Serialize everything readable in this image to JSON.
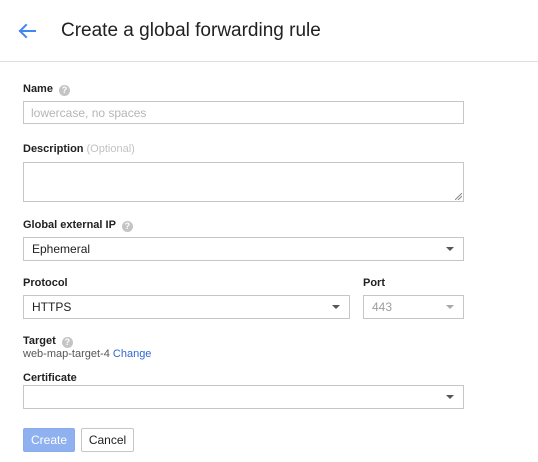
{
  "header": {
    "title": "Create a global forwarding rule",
    "back_icon": "arrow-left-icon"
  },
  "form": {
    "name": {
      "label": "Name",
      "help_icon": "help-icon",
      "value": "",
      "placeholder": "lowercase, no spaces"
    },
    "description": {
      "label": "Description",
      "optional_hint": "(Optional)",
      "value": ""
    },
    "global_ip": {
      "label": "Global external IP",
      "help_icon": "help-icon",
      "selected": "Ephemeral"
    },
    "protocol": {
      "label": "Protocol",
      "selected": "HTTPS"
    },
    "port": {
      "label": "Port",
      "selected": "443",
      "disabled": true
    },
    "target": {
      "label": "Target",
      "help_icon": "help-icon",
      "value": "web-map-target-4",
      "change_link": "Change"
    },
    "certificate": {
      "label": "Certificate",
      "selected": ""
    }
  },
  "actions": {
    "create_label": "Create",
    "cancel_label": "Cancel"
  },
  "colors": {
    "link": "#3367d6",
    "primary_button_disabled": "#8fb1f0",
    "back_arrow": "#4285f4"
  }
}
